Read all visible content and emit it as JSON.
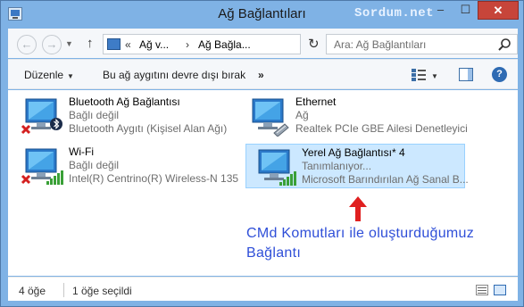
{
  "window": {
    "title": "Ağ Bağlantıları",
    "watermark": "Sordum.net",
    "controls": {
      "minimize": "–",
      "maximize": "☐",
      "close": "✕"
    }
  },
  "nav": {
    "address_parts": [
      "«",
      "Ağ v...",
      "›",
      "Ağ Bağla..."
    ],
    "search_placeholder": "Ara: Ağ Bağlantıları"
  },
  "toolbar": {
    "organize": "Düzenle",
    "disable_device": "Bu ağ aygıtını devre dışı bırak",
    "more": "»"
  },
  "connections": [
    {
      "name": "Bluetooth Ağ Bağlantısı",
      "status": "Bağlı değil",
      "device": "Bluetooth Aygıtı (Kişisel Alan Ağı)",
      "kind": "bluetooth",
      "disconnected": true,
      "selected": false
    },
    {
      "name": "Ethernet",
      "status": "Ağ",
      "device": "Realtek PCIe GBE Ailesi Denetleyici",
      "kind": "ethernet",
      "disconnected": false,
      "selected": false
    },
    {
      "name": "Wi-Fi",
      "status": "Bağlı değil",
      "device": "Intel(R) Centrino(R) Wireless-N 135",
      "kind": "wifi",
      "disconnected": true,
      "selected": false
    },
    {
      "name": "Yerel Ağ Bağlantısı* 4",
      "status": "Tanımlanıyor...",
      "device": "Microsoft Barındırılan Ağ Sanal B...",
      "kind": "wifi",
      "disconnected": false,
      "selected": true
    }
  ],
  "annotation": {
    "line1": "CMd Komutları ile oluşturduğumuz",
    "line2": "Bağlantı",
    "color": "#2f4fd8",
    "arrow_color": "#e02020"
  },
  "status": {
    "count": "4 öğe",
    "selected": "1 öğe seçildi"
  },
  "colors": {
    "selection": "#cce8ff",
    "accent": "#2f6bb3",
    "disconnected_x": "#d42020"
  }
}
